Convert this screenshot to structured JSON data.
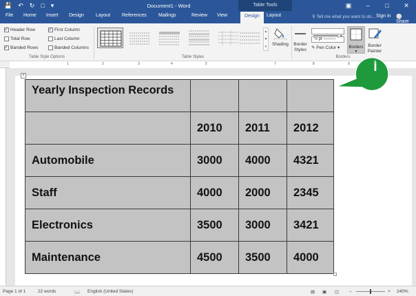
{
  "titlebar": {
    "doc_title": "Document1 - Word",
    "context_tab": "Table Tools",
    "qat_icons": [
      "save-icon",
      "undo-icon",
      "redo-icon",
      "touch-mode-icon",
      "customize-qat-icon"
    ],
    "window_icons": [
      "ribbon-display-icon",
      "minimize-icon",
      "maximize-icon",
      "close-icon"
    ]
  },
  "tabs": [
    "File",
    "Home",
    "Insert",
    "Design",
    "Layout",
    "References",
    "Mailings",
    "Review",
    "View",
    "Design",
    "Layout"
  ],
  "active_tab": "Design",
  "tell_me": "Tell me what you want to do...",
  "sign_in": "Sign in",
  "share": "Share",
  "ribbon": {
    "style_options": {
      "items": [
        {
          "label": "Header Row",
          "checked": true
        },
        {
          "label": "First Column",
          "checked": true
        },
        {
          "label": "Total Row",
          "checked": false
        },
        {
          "label": "Last Column",
          "checked": false
        },
        {
          "label": "Banded Rows",
          "checked": true
        },
        {
          "label": "Banded Columns",
          "checked": false
        }
      ],
      "group_label": "Table Style Options"
    },
    "table_styles_label": "Table Styles",
    "shading_label": "Shading",
    "border_styles_label": "Border Styles",
    "pen_weight": "½ pt",
    "pen_color_label": "Pen Color",
    "borders_label": "Borders",
    "border_painter_label": "Border Painter",
    "borders_group_label": "Borders"
  },
  "ruler_numbers": [
    "1",
    "2",
    "3",
    "4",
    "5",
    "7",
    "8",
    "9"
  ],
  "table": {
    "rows": [
      [
        "Yearly Inspection Records",
        "",
        "",
        ""
      ],
      [
        "",
        "2010",
        "2011",
        "2012"
      ],
      [
        "Automobile",
        "3000",
        "4000",
        "4321"
      ],
      [
        "Staff",
        "4000",
        "2000",
        "2345"
      ],
      [
        "Electronics",
        "3500",
        "3000",
        "3421"
      ],
      [
        "Maintenance",
        "4500",
        "3500",
        "4000"
      ]
    ],
    "fill_color": "#c3c3c3"
  },
  "callout": {
    "label": "أ",
    "color": "#1e9a3c"
  },
  "status": {
    "page": "Page 1 of 1",
    "words": "22 words",
    "language": "English (United States)",
    "zoom": "240%"
  }
}
